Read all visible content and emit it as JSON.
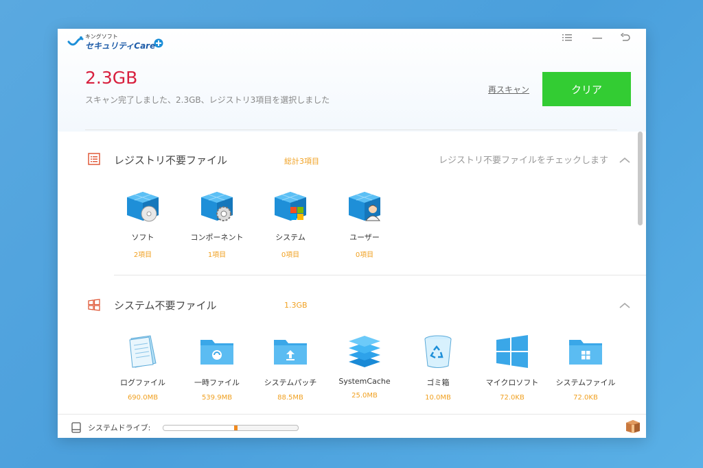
{
  "app": {
    "logo_small": "キングソフト",
    "logo_main": "セキュリティCare"
  },
  "summary": {
    "size": "2.3GB",
    "status": "スキャン完了しました、2.3GB、レジストリ3項目を選択しました",
    "rescan_label": "再スキャン",
    "clear_label": "クリア"
  },
  "registry": {
    "title": "レジストリ不要ファイル",
    "count": "総計3項目",
    "desc": "レジストリ不要ファイルをチェックします",
    "items": [
      {
        "label": "ソフト",
        "value": "2項目",
        "icon": "registry-software-icon"
      },
      {
        "label": "コンポーネント",
        "value": "1項目",
        "icon": "registry-component-icon"
      },
      {
        "label": "システム",
        "value": "0項目",
        "icon": "registry-system-icon"
      },
      {
        "label": "ユーザー",
        "value": "0項目",
        "icon": "registry-user-icon"
      }
    ]
  },
  "system": {
    "title": "システム不要ファイル",
    "count": "1.3GB",
    "items": [
      {
        "label": "ログファイル",
        "value": "690.0MB",
        "icon": "log-file-icon"
      },
      {
        "label": "一時ファイル",
        "value": "539.9MB",
        "icon": "temp-folder-icon"
      },
      {
        "label": "システムパッチ",
        "value": "88.5MB",
        "icon": "patch-folder-icon"
      },
      {
        "label": "SystemCache",
        "value": "25.0MB",
        "icon": "system-cache-icon"
      },
      {
        "label": "ゴミ箱",
        "value": "10.0MB",
        "icon": "recycle-bin-icon"
      },
      {
        "label": "マイクロソフト",
        "value": "72.0KB",
        "icon": "microsoft-icon"
      },
      {
        "label": "システムファイル",
        "value": "72.0KB",
        "icon": "system-file-folder-icon"
      }
    ]
  },
  "footer": {
    "drive_label": "システムドライブ:",
    "drive_usage_fraction": 0.55
  },
  "colors": {
    "accent_red": "#d8203e",
    "clear_green": "#33cc33",
    "count_orange": "#f0a020",
    "background_blue": "#4a9fdc"
  }
}
